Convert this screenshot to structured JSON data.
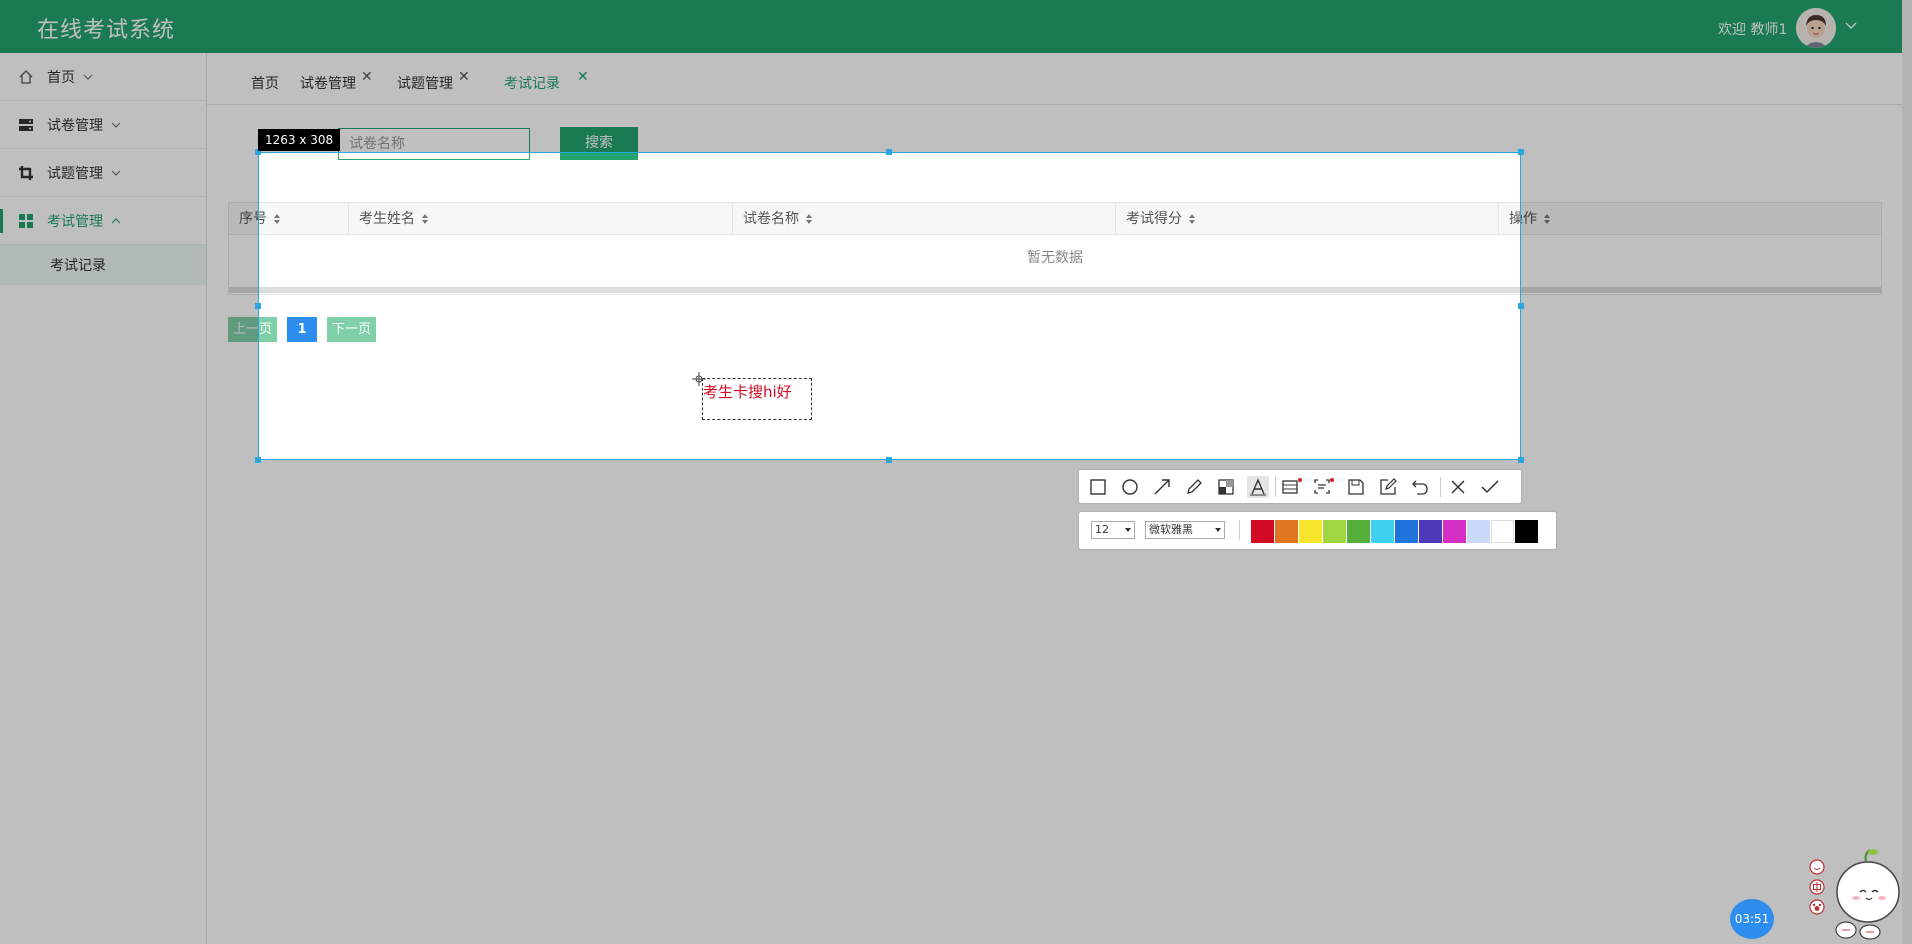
{
  "header": {
    "title": "在线考试系统",
    "welcome": "欢迎 教师1"
  },
  "sidebar": {
    "items": [
      {
        "label": "首页",
        "icon": "home-icon",
        "expanded": false
      },
      {
        "label": "试卷管理",
        "icon": "server-icon",
        "expanded": false
      },
      {
        "label": "试题管理",
        "icon": "crop-icon",
        "expanded": false
      },
      {
        "label": "考试管理",
        "icon": "grid-icon",
        "expanded": true,
        "active": true
      }
    ],
    "sub_items": [
      {
        "label": "考试记录"
      }
    ]
  },
  "tabs": [
    {
      "label": "首页",
      "closable": false
    },
    {
      "label": "试卷管理",
      "closable": true
    },
    {
      "label": "试题管理",
      "closable": true
    },
    {
      "label": "考试记录",
      "closable": true,
      "active": true
    }
  ],
  "search": {
    "placeholder": "试卷名称",
    "button_label": "搜索"
  },
  "table": {
    "columns": [
      "序号",
      "考生姓名",
      "试卷名称",
      "考试得分",
      "操作"
    ],
    "empty_text": "暂无数据"
  },
  "pagination": {
    "prev_label": "上一页",
    "current_page": "1",
    "next_label": "下一页"
  },
  "screenshot_tool": {
    "dimensions_label": "1263 x 308",
    "annotation_text": "考生卡搜hi好",
    "font_size": "12",
    "font_family": "微软雅黑",
    "colors": [
      "#d20a23",
      "#e07520",
      "#f6e52b",
      "#a0d641",
      "#54af3b",
      "#3ed1ef",
      "#1f75d9",
      "#4c3ab8",
      "#d52ec3",
      "#c9d9fa",
      "#ffffff",
      "#000000"
    ],
    "accent_color": "#2aa7e0"
  },
  "clock": {
    "time": "03:51"
  },
  "mascot_icons": [
    "smile-icon",
    "chinese-char-icon",
    "paw-icon"
  ],
  "brand_color": "#23a46e"
}
